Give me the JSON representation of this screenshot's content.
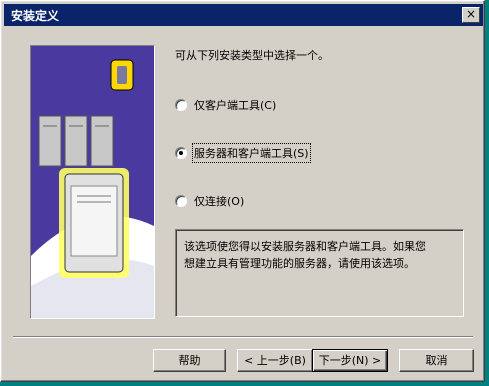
{
  "window": {
    "title": "安装定义",
    "close_label": "×"
  },
  "prompt": "可从下列安装类型中选择一个。",
  "options": [
    {
      "label": "仅客户端工具(C)",
      "checked": false
    },
    {
      "label": "服务器和客户端工具(S)",
      "checked": true
    },
    {
      "label": "仅连接(O)",
      "checked": false
    }
  ],
  "description": "该选项使您得以安装服务器和客户端工具。如果您\n想建立具有管理功能的服务器，请使用该选项。",
  "buttons": {
    "help": "帮助",
    "back": "< 上一步(B)",
    "next": "下一步(N) >",
    "cancel": "取消"
  }
}
